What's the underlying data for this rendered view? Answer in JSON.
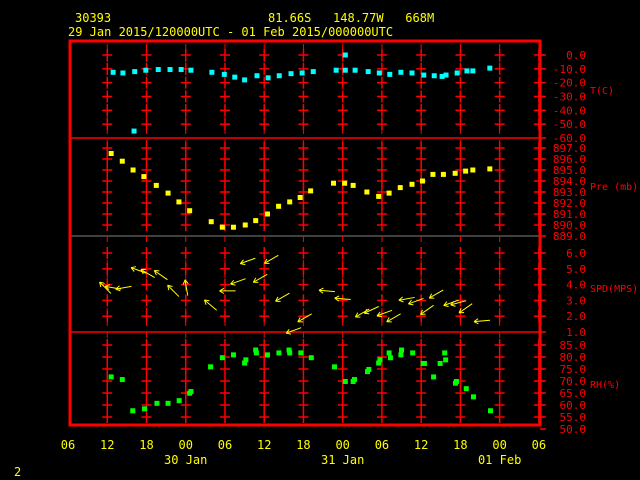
{
  "header": {
    "station_id": "30393",
    "location": "81.66S   148.77W   668M",
    "time_range": "29 Jan 2015/120000UTC - 01 Feb 2015/000000UTC"
  },
  "footer": {
    "frame_number": "2"
  },
  "colors": {
    "frame": "#ff0000",
    "text": "#ffff00",
    "temperature": "#00ffff",
    "pressure": "#ffff00",
    "wind": "#ffff00",
    "rh": "#00ff00",
    "grid_alt": "#808080"
  },
  "chart_data": {
    "type": "scatter",
    "x_axis": {
      "unit": "hours since 29 Jan 2015 06UTC",
      "range": [
        0,
        72
      ],
      "tick_labels": [
        "06",
        "12",
        "18",
        "00",
        "06",
        "12",
        "18",
        "00",
        "06",
        "12",
        "18",
        "00",
        "06"
      ],
      "date_labels": [
        {
          "label": "30 Jan",
          "hour": 18
        },
        {
          "label": "31 Jan",
          "hour": 42
        },
        {
          "label": "01 Feb",
          "hour": 66
        }
      ]
    },
    "panels": [
      {
        "name": "temperature",
        "ylabel": "T(C)",
        "ylim": [
          -60,
          0
        ],
        "tick_labels": [
          "0.0",
          "-10.0",
          "-20.0",
          "-30.0",
          "-40.0",
          "-50.0",
          "-60.0"
        ],
        "points": [
          [
            6.9,
            -12.5
          ],
          [
            8.4,
            -13
          ],
          [
            10.2,
            -12
          ],
          [
            11.9,
            -11
          ],
          [
            13.8,
            -10.5
          ],
          [
            15.6,
            -10.5
          ],
          [
            17.3,
            -10.5
          ],
          [
            18.8,
            -11
          ],
          [
            22,
            -12.5
          ],
          [
            23.9,
            -14
          ],
          [
            25.5,
            -16
          ],
          [
            27,
            -18
          ],
          [
            28.9,
            -15
          ],
          [
            30.6,
            -16.5
          ],
          [
            32.3,
            -15
          ],
          [
            34.1,
            -13.5
          ],
          [
            35.8,
            -13
          ],
          [
            37.5,
            -12
          ],
          [
            41,
            -11
          ],
          [
            42.4,
            -11
          ],
          [
            43.9,
            -11
          ],
          [
            45.9,
            -12
          ],
          [
            47.6,
            -13
          ],
          [
            49.2,
            -14
          ],
          [
            50.9,
            -12.5
          ],
          [
            52.6,
            -13
          ],
          [
            54.4,
            -14.5
          ],
          [
            56,
            -15
          ],
          [
            57.2,
            -15.5
          ],
          [
            57.8,
            -14.5
          ],
          [
            59.5,
            -13
          ],
          [
            61,
            -11.5
          ],
          [
            61.9,
            -11.5
          ],
          [
            64.5,
            -9.5
          ],
          [
            10.1,
            -55
          ],
          [
            42.4,
            0
          ]
        ]
      },
      {
        "name": "pressure",
        "ylabel": "Pre (mb)",
        "ylim": [
          889,
          897
        ],
        "tick_labels": [
          "897.0",
          "896.0",
          "895.0",
          "894.0",
          "893.0",
          "892.0",
          "891.0",
          "890.0",
          "889.0"
        ],
        "points": [
          [
            6.6,
            896.5
          ],
          [
            8.3,
            895.8
          ],
          [
            9.95,
            895.0
          ],
          [
            11.6,
            894.4
          ],
          [
            13.5,
            893.6
          ],
          [
            15.3,
            892.9
          ],
          [
            16.96,
            892.1
          ],
          [
            18.6,
            891.3
          ],
          [
            21.9,
            890.3
          ],
          [
            23.6,
            889.8
          ],
          [
            25.3,
            889.8
          ],
          [
            27.1,
            890.0
          ],
          [
            28.7,
            890.4
          ],
          [
            30.5,
            891.0
          ],
          [
            32.2,
            891.7
          ],
          [
            33.9,
            892.1
          ],
          [
            35.5,
            892.5
          ],
          [
            37.1,
            893.1
          ],
          [
            40.6,
            893.8
          ],
          [
            42.3,
            893.8
          ],
          [
            43.6,
            893.6
          ],
          [
            45.7,
            893.0
          ],
          [
            47.5,
            892.6
          ],
          [
            49.1,
            892.9
          ],
          [
            50.8,
            893.4
          ],
          [
            52.6,
            893.7
          ],
          [
            54.2,
            894.0
          ],
          [
            55.8,
            894.6
          ],
          [
            57.4,
            894.6
          ],
          [
            59.2,
            894.7
          ],
          [
            60.8,
            894.9
          ],
          [
            61.9,
            895.0
          ],
          [
            64.5,
            895.1
          ]
        ]
      },
      {
        "name": "wind",
        "ylabel": "SPD(MPS)",
        "ylim": [
          1,
          6
        ],
        "tick_labels": [
          "6.0",
          "5.0",
          "4.0",
          "3.0",
          "2.0",
          "1.0"
        ],
        "points_hour_speed_dir": [
          [
            5.7,
            3.8,
            135
          ],
          [
            6.9,
            3.8,
            100
          ],
          [
            8.5,
            3.8,
            80
          ],
          [
            10.8,
            4.9,
            110
          ],
          [
            12.2,
            4.7,
            120
          ],
          [
            14.2,
            4.6,
            125
          ],
          [
            16.1,
            3.6,
            135
          ],
          [
            18.1,
            3.8,
            170
          ],
          [
            21.8,
            2.7,
            130
          ],
          [
            24.4,
            3.6,
            90
          ],
          [
            26,
            4.2,
            70
          ],
          [
            27.5,
            5.5,
            70
          ],
          [
            29.4,
            4.4,
            60
          ],
          [
            31.1,
            5.6,
            60
          ],
          [
            32.8,
            3.2,
            60
          ],
          [
            34.5,
            1.1,
            70
          ],
          [
            36.2,
            1.9,
            60
          ],
          [
            39.6,
            3.6,
            95
          ],
          [
            42,
            3.1,
            95
          ],
          [
            45,
            2.2,
            60
          ],
          [
            46.4,
            2.4,
            65
          ],
          [
            48.4,
            2.2,
            70
          ],
          [
            49.8,
            1.9,
            60
          ],
          [
            51.8,
            3.1,
            80
          ],
          [
            53.2,
            2.95,
            70
          ],
          [
            54.9,
            2.4,
            55
          ],
          [
            56.3,
            3.4,
            60
          ],
          [
            58.6,
            2.85,
            70
          ],
          [
            59.7,
            2.85,
            75
          ],
          [
            60.8,
            2.5,
            55
          ],
          [
            63.3,
            1.7,
            85
          ]
        ]
      },
      {
        "name": "rh",
        "ylabel": "RH(%)",
        "ylim": [
          50,
          85
        ],
        "tick_labels": [
          "85.0",
          "80.0",
          "75.0",
          "70.0",
          "65.0",
          "60.0",
          "55.0",
          "50.0"
        ],
        "points": [
          [
            6.6,
            71.7
          ],
          [
            8.3,
            70.6
          ],
          [
            9.9,
            57.6
          ],
          [
            11.7,
            58.4
          ],
          [
            13.6,
            60.7
          ],
          [
            15.3,
            60.7
          ],
          [
            17,
            61.8
          ],
          [
            18.6,
            64.9
          ],
          [
            18.8,
            65.6
          ],
          [
            21.8,
            75.9
          ],
          [
            23.6,
            79.7
          ],
          [
            25.3,
            80.9
          ],
          [
            27,
            77.5
          ],
          [
            27.2,
            78.8
          ],
          [
            28.7,
            82.9
          ],
          [
            28.8,
            81.7
          ],
          [
            30.5,
            80.9
          ],
          [
            32.25,
            81.7
          ],
          [
            33.8,
            82.9
          ],
          [
            33.9,
            81.7
          ],
          [
            35.6,
            81.7
          ],
          [
            37.2,
            79.7
          ],
          [
            40.75,
            75.9
          ],
          [
            42.4,
            69.8
          ],
          [
            43.6,
            69.8
          ],
          [
            43.8,
            70.6
          ],
          [
            45.8,
            73.9
          ],
          [
            46,
            74.8
          ],
          [
            47.5,
            77.5
          ],
          [
            47.7,
            78.8
          ],
          [
            49.1,
            81.7
          ],
          [
            49.3,
            79.7
          ],
          [
            50.9,
            80.9
          ],
          [
            51,
            82.9
          ],
          [
            52.7,
            81.7
          ],
          [
            54.3,
            77.3
          ],
          [
            54.5,
            77.3
          ],
          [
            55.9,
            71.7
          ],
          [
            56.9,
            77.3
          ],
          [
            57.6,
            81.7
          ],
          [
            57.75,
            78.8
          ],
          [
            59.25,
            69.1
          ],
          [
            59.4,
            69.8
          ],
          [
            60.9,
            66.8
          ],
          [
            62,
            63.4
          ],
          [
            64.6,
            57.6
          ]
        ]
      }
    ]
  }
}
